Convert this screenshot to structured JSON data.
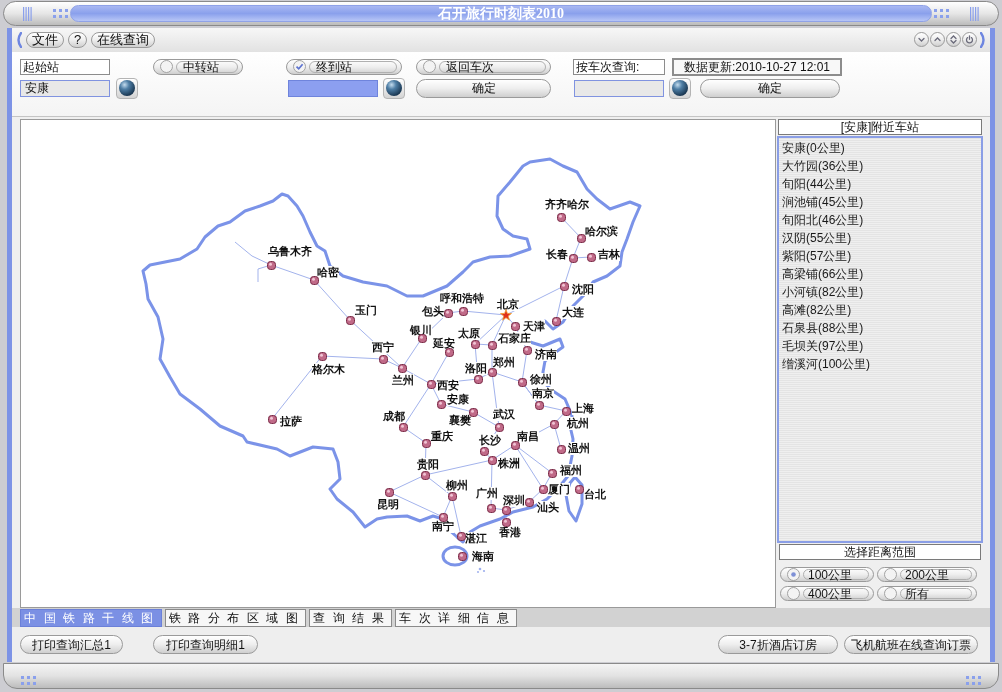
{
  "window": {
    "title": "石开旅行时刻表2010"
  },
  "menu": [
    {
      "label": "文件"
    },
    {
      "label": "?"
    },
    {
      "label": "在线查询"
    }
  ],
  "query": {
    "origin_label": "起始站",
    "origin_value": "安康",
    "options": [
      {
        "label": "中转站",
        "checked": false
      },
      {
        "label": "终到站",
        "checked": true
      },
      {
        "label": "返回车次",
        "checked": false
      }
    ],
    "destination_field": {
      "focused": true
    },
    "confirm_button": "确定",
    "train_label": "按车次查询:",
    "data_update": "数据更新:2010-10-27 12:01",
    "train_confirm_button": "确定"
  },
  "map": {
    "cities": [
      {
        "name": "齐齐哈尔",
        "kind": "city"
      },
      {
        "name": "哈尔滨",
        "kind": "city"
      },
      {
        "name": "乌鲁木齐",
        "kind": "city"
      },
      {
        "name": "长春",
        "kind": "city"
      },
      {
        "name": "吉林",
        "kind": "city"
      },
      {
        "name": "哈密",
        "kind": "city"
      },
      {
        "name": "沈阳",
        "kind": "city"
      },
      {
        "name": "呼和浩特",
        "kind": "city"
      },
      {
        "name": "北京",
        "kind": "capital"
      },
      {
        "name": "玉门",
        "kind": "city"
      },
      {
        "name": "包头",
        "kind": "city"
      },
      {
        "name": "大连",
        "kind": "city"
      },
      {
        "name": "银川",
        "kind": "city"
      },
      {
        "name": "太原",
        "kind": "city"
      },
      {
        "name": "天津",
        "kind": "city"
      },
      {
        "name": "西宁",
        "kind": "city"
      },
      {
        "name": "延安",
        "kind": "city"
      },
      {
        "name": "石家庄",
        "kind": "city"
      },
      {
        "name": "济南",
        "kind": "city"
      },
      {
        "name": "格尔木",
        "kind": "city"
      },
      {
        "name": "洛阳",
        "kind": "city"
      },
      {
        "name": "郑州",
        "kind": "city"
      },
      {
        "name": "兰州",
        "kind": "city"
      },
      {
        "name": "西安",
        "kind": "city"
      },
      {
        "name": "徐州",
        "kind": "city"
      },
      {
        "name": "安康",
        "kind": "city"
      },
      {
        "name": "南京",
        "kind": "city"
      },
      {
        "name": "拉萨",
        "kind": "city"
      },
      {
        "name": "成都",
        "kind": "city"
      },
      {
        "name": "襄樊",
        "kind": "city"
      },
      {
        "name": "武汉",
        "kind": "city"
      },
      {
        "name": "上海",
        "kind": "city"
      },
      {
        "name": "杭州",
        "kind": "city"
      },
      {
        "name": "重庆",
        "kind": "city"
      },
      {
        "name": "长沙",
        "kind": "city"
      },
      {
        "name": "南昌",
        "kind": "city"
      },
      {
        "name": "温州",
        "kind": "city"
      },
      {
        "name": "贵阳",
        "kind": "city"
      },
      {
        "name": "株洲",
        "kind": "city"
      },
      {
        "name": "福州",
        "kind": "city"
      },
      {
        "name": "柳州",
        "kind": "city"
      },
      {
        "name": "广州",
        "kind": "city"
      },
      {
        "name": "厦门",
        "kind": "city"
      },
      {
        "name": "台北",
        "kind": "city"
      },
      {
        "name": "昆明",
        "kind": "city"
      },
      {
        "name": "深圳",
        "kind": "city"
      },
      {
        "name": "汕头",
        "kind": "city"
      },
      {
        "name": "南宁",
        "kind": "city"
      },
      {
        "name": "湛江",
        "kind": "city"
      },
      {
        "name": "香港",
        "kind": "city"
      },
      {
        "name": "海南",
        "kind": "city"
      }
    ]
  },
  "nearby": {
    "title": "[安康]附近车站",
    "stations": [
      "安康(0公里)",
      "大竹园(36公里)",
      "旬阳(44公里)",
      "涧池铺(45公里)",
      "旬阳北(46公里)",
      "汉阴(55公里)",
      "紫阳(57公里)",
      "高梁铺(66公里)",
      "小河镇(82公里)",
      "高滩(82公里)",
      "石泉县(88公里)",
      "毛坝关(97公里)",
      "缯溪河(100公里)"
    ]
  },
  "range": {
    "title": "选择距离范围",
    "options": [
      {
        "label": "100公里",
        "selected": true
      },
      {
        "label": "200公里",
        "selected": false
      },
      {
        "label": "400公里",
        "selected": false
      },
      {
        "label": "所有",
        "selected": false
      }
    ]
  },
  "tabs": [
    {
      "label": "中国铁路干线图",
      "selected": true
    },
    {
      "label": "铁路分布区域图",
      "selected": false
    },
    {
      "label": "查询结果",
      "selected": false
    },
    {
      "label": "车次详细信息",
      "selected": false
    }
  ],
  "actions": {
    "left": [
      "打印查询汇总1",
      "打印查询明细1"
    ],
    "right": [
      "3-7折酒店订房",
      "飞机航班在线查询订票"
    ]
  }
}
